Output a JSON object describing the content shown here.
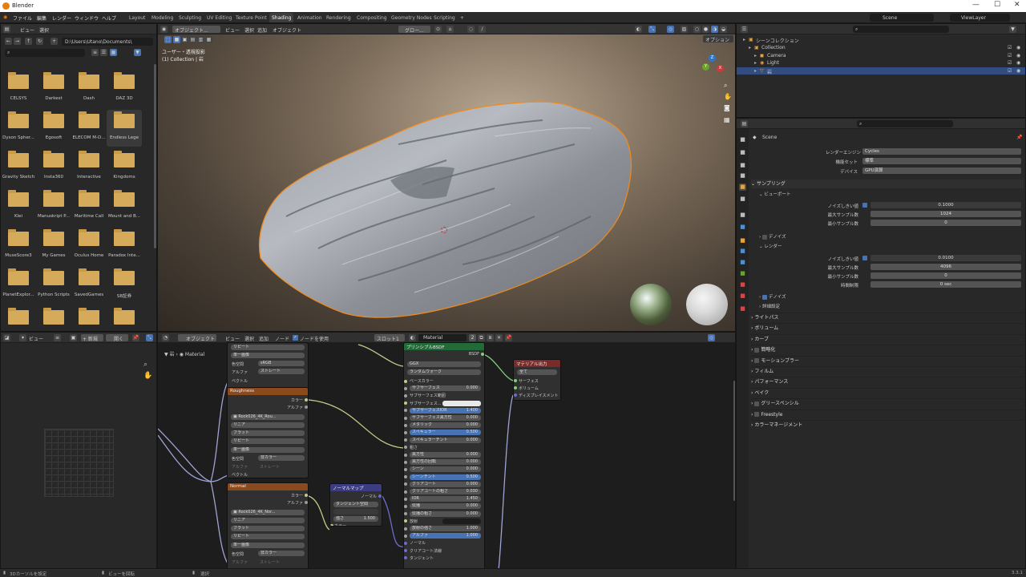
{
  "window": {
    "title": "Blender"
  },
  "menubar": {
    "menus": [
      "ファイル",
      "編集",
      "レンダー",
      "ウィンドウ",
      "ヘルプ"
    ],
    "workspaces": [
      "Layout",
      "Modeling",
      "Sculpting",
      "UV Editing",
      "Texture Point",
      "Shading",
      "Animation",
      "Rendering",
      "Compositing",
      "Geometry Nodes",
      "Scripting"
    ],
    "active_workspace": "Shading",
    "add_tab": "+",
    "scene": "Scene",
    "view_layer": "ViewLayer"
  },
  "file_browser": {
    "header": [
      "ビュー",
      "選択"
    ],
    "path": "D:\\Users\\Utano\\Documents\\",
    "folders": [
      "CELSYS",
      "Darkest",
      "Dash",
      "DAZ 3D",
      "Dyson Spher...",
      "Egosoft",
      "ELECOM M-D...",
      "Endless Lege",
      "Gravity Sketch",
      "Insta360",
      "Interactive",
      "Kingdoms",
      "Klei",
      "Manuskript P...",
      "Maritime Call",
      "Mount and B...",
      "MuseScore3",
      "My Games",
      "Oculus Home",
      "Paradox Inte...",
      "PlanetExplor...",
      "Python Scripts",
      "SavedGames",
      "SB証券",
      "",
      "",
      "",
      ""
    ]
  },
  "viewport": {
    "header": [
      "オブジェクト...",
      "ビュー",
      "選択",
      "追加",
      "オブジェクト"
    ],
    "transform": "グロー...",
    "options": "オプション",
    "overlay_line1": "ユーザー・透視投影",
    "overlay_line2": "(1) Collection | 岩",
    "gizmo": {
      "x": "X",
      "y": "Y",
      "z": "Z"
    }
  },
  "image_editor": {
    "header": [
      "ビュー"
    ],
    "new_button": "+ 新規",
    "open_button": "開く"
  },
  "node_editor": {
    "header": [
      "オブジェクト",
      "ビュー",
      "選択",
      "追加",
      "ノード"
    ],
    "use_nodes": "ノードを使用",
    "slot": "スロット1",
    "material": "Material",
    "users": "2",
    "breadcrumb": [
      "岩",
      "Material"
    ],
    "nodes": {
      "top_node_rows": [
        "リピート",
        "単一画像",
        "色空間",
        "sRGB",
        "アルファ",
        "ストレート",
        "ベクトル"
      ],
      "roughness": {
        "title": "Roughness",
        "out_color": "カラー",
        "out_alpha": "アルファ",
        "image": "Rock026_4K_Rou...",
        "rows": [
          "リニア",
          "フラット",
          "リピート",
          "単一画像"
        ],
        "colorspace_label": "色空間",
        "colorspace": "非カラー",
        "alpha_label": "アルファ",
        "alpha": "ストレート",
        "vector": "ベクトル"
      },
      "normal": {
        "title": "Normal",
        "out_color": "カラー",
        "out_alpha": "アルファ",
        "image": "Rock026_4K_Nor...",
        "rows": [
          "リニア",
          "フラット",
          "リピート",
          "単一画像"
        ],
        "colorspace_label": "色空間",
        "colorspace": "非カラー",
        "alpha_label": "アルファ",
        "alpha": "ストレート"
      },
      "normal_map": {
        "title": "ノーマルマップ",
        "out": "ノーマル",
        "space": "タンジェント空間",
        "strength_label": "強さ",
        "strength": "1.500",
        "color": "カラー"
      },
      "bsdf": {
        "title": "プリンシプルBSDF",
        "out": "BSDF",
        "distribution": "GGX",
        "sss_method": "ランダムウォーク",
        "rows": [
          {
            "label": "ベースカラー",
            "value": "",
            "kind": "socket"
          },
          {
            "label": "サブサーフェス",
            "value": "0.000",
            "kind": "field"
          },
          {
            "label": "サブサーフェス範囲",
            "value": "",
            "kind": "dropdown"
          },
          {
            "label": "サブサーフェス...",
            "value": "",
            "kind": "color"
          },
          {
            "label": "サブサーフェスIOR",
            "value": "1.400",
            "kind": "blue"
          },
          {
            "label": "サブサーフェス異方性",
            "value": "0.000",
            "kind": "field"
          },
          {
            "label": "メタリック",
            "value": "0.000",
            "kind": "field"
          },
          {
            "label": "スペキュラー",
            "value": "0.500",
            "kind": "blue"
          },
          {
            "label": "スペキュラーチント",
            "value": "0.000",
            "kind": "field"
          },
          {
            "label": "粗さ",
            "value": "",
            "kind": "socket"
          },
          {
            "label": "異方性",
            "value": "0.000",
            "kind": "field"
          },
          {
            "label": "異方性の回転",
            "value": "0.000",
            "kind": "field"
          },
          {
            "label": "シーン",
            "value": "0.000",
            "kind": "field"
          },
          {
            "label": "シーンチント",
            "value": "0.500",
            "kind": "blue"
          },
          {
            "label": "クリアコート",
            "value": "0.000",
            "kind": "field"
          },
          {
            "label": "クリアコートの粗さ",
            "value": "0.030",
            "kind": "field"
          },
          {
            "label": "IOR",
            "value": "1.450",
            "kind": "field"
          },
          {
            "label": "伝播",
            "value": "0.000",
            "kind": "field"
          },
          {
            "label": "伝播の粗さ",
            "value": "0.000",
            "kind": "field"
          },
          {
            "label": "放射",
            "value": "",
            "kind": "dark"
          },
          {
            "label": "放射の強さ",
            "value": "1.000",
            "kind": "field"
          },
          {
            "label": "アルファ",
            "value": "1.000",
            "kind": "blue"
          },
          {
            "label": "ノーマル",
            "value": "",
            "kind": "socket"
          },
          {
            "label": "クリアコート法線",
            "value": "",
            "kind": "socket"
          },
          {
            "label": "タンジェント",
            "value": "",
            "kind": "socket"
          }
        ]
      },
      "output": {
        "title": "マテリアル出力",
        "target": "全て",
        "sockets": [
          "サーフェス",
          "ボリューム",
          "ディスプレイスメント"
        ]
      }
    }
  },
  "outliner": {
    "items": [
      {
        "label": "シーンコレクション",
        "indent": 0,
        "selected": false
      },
      {
        "label": "Collection",
        "indent": 1,
        "selected": false
      },
      {
        "label": "Camera",
        "indent": 2,
        "selected": false
      },
      {
        "label": "Light",
        "indent": 2,
        "selected": false
      },
      {
        "label": "岩",
        "indent": 2,
        "selected": true
      }
    ]
  },
  "properties": {
    "scene_name": "Scene",
    "fields": [
      {
        "label": "レンダーエンジン",
        "value": "Cycles"
      },
      {
        "label": "機能セット",
        "value": "標準"
      },
      {
        "label": "デバイス",
        "value": "GPU演算"
      }
    ],
    "sampling": "サンプリング",
    "viewport": "ビューポート",
    "viewport_fields": [
      {
        "label": "ノイズしきい値",
        "value": "0.1000"
      },
      {
        "label": "最大サンプル数",
        "value": "1024"
      },
      {
        "label": "最小サンプル数",
        "value": "0"
      }
    ],
    "denoise": "デノイズ",
    "render": "レンダー",
    "render_fields": [
      {
        "label": "ノイズしきい値",
        "value": "0.0100"
      },
      {
        "label": "最大サンプル数",
        "value": "4096"
      },
      {
        "label": "最小サンプル数",
        "value": "0"
      },
      {
        "label": "時間制限",
        "value": "0 sec"
      }
    ],
    "denoise2": "デノイズ",
    "advanced": "詳細設定",
    "sections": [
      "ライトパス",
      "ボリューム",
      "カーブ",
      "簡略化",
      "モーションブラー",
      "フィルム",
      "パフォーマンス",
      "ベイク",
      "グリースペンシル",
      "Freestyle",
      "カラーマネージメント"
    ]
  },
  "statusbar": {
    "left": "3Dカーソルを設定",
    "mid": "ビューを回転",
    "select": "選択",
    "version": "3.3.1"
  }
}
